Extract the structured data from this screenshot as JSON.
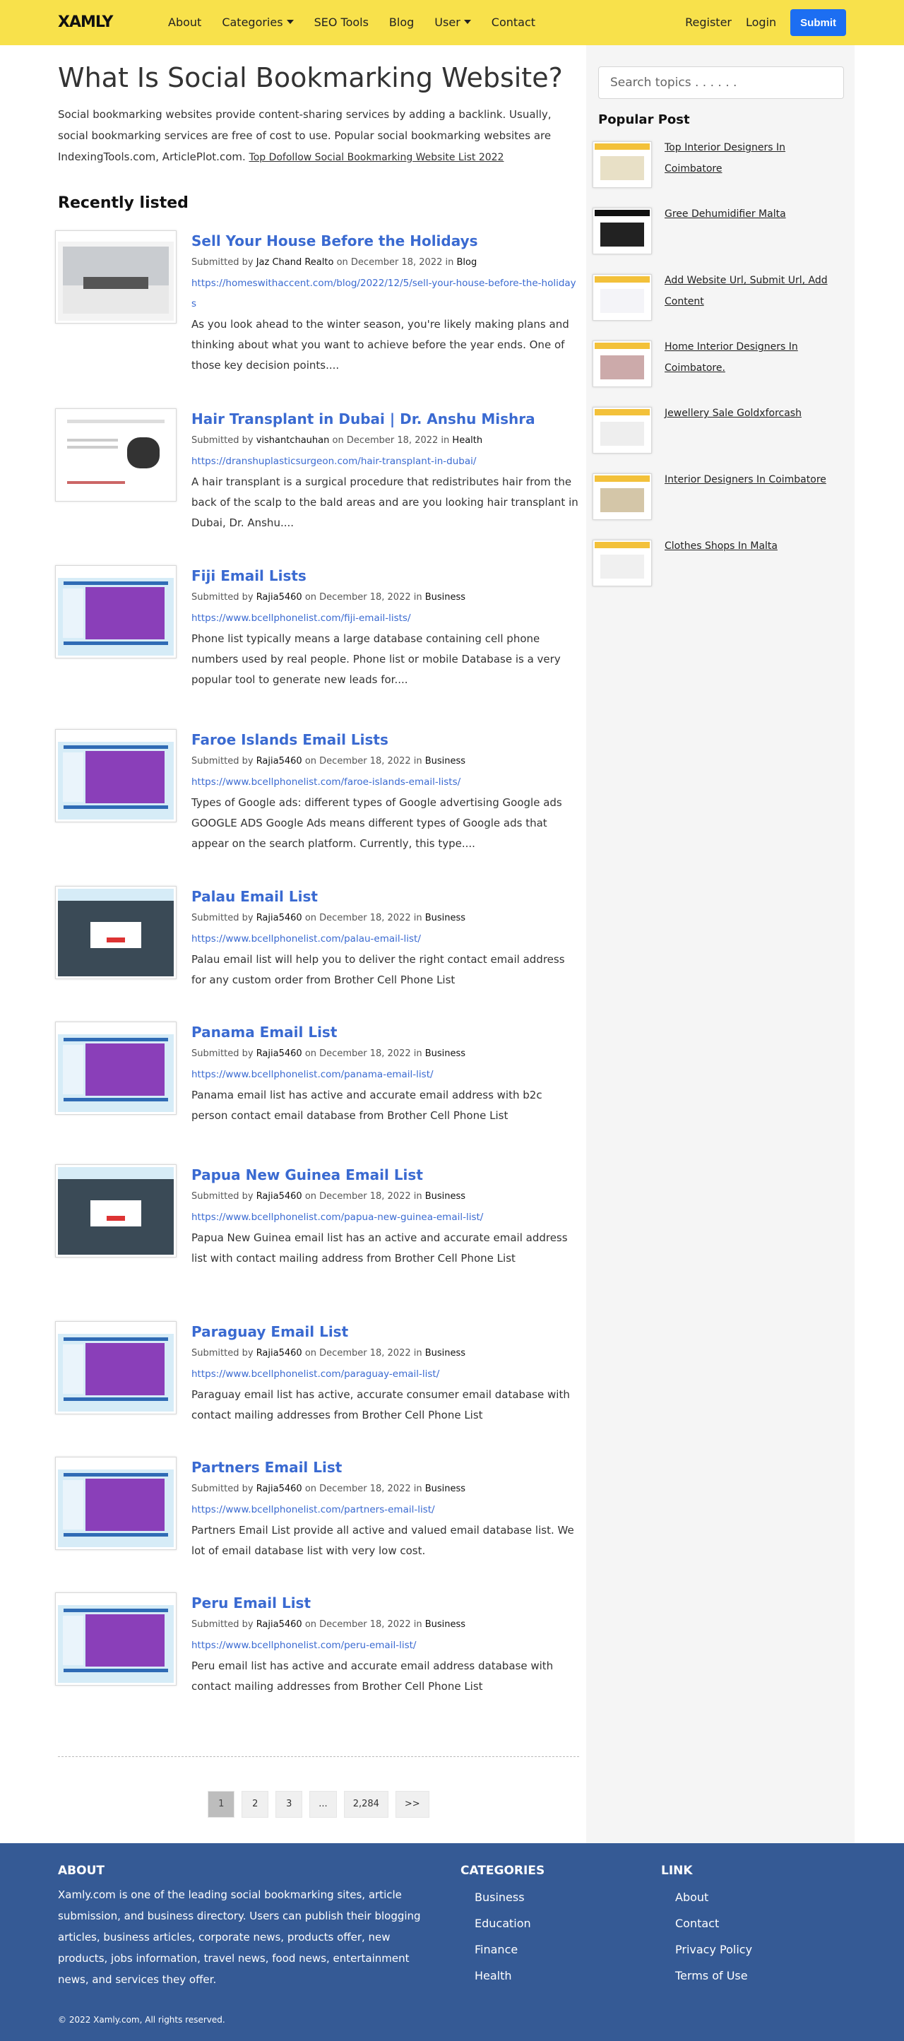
{
  "nav": {
    "logo": "XAMLY",
    "links": [
      "About",
      "Categories",
      "SEO Tools",
      "Blog",
      "User",
      "Contact"
    ],
    "register": "Register",
    "login": "Login",
    "submit": "Submit"
  },
  "page": {
    "title": "What Is Social Bookmarking Website?",
    "intro": "Social bookmarking websites provide content-sharing services by adding a backlink. Usually, social bookmarking services are free of cost to use. Popular social bookmarking websites are IndexingTools.com, ArticlePlot.com. ",
    "intro_link": "Top Dofollow Social Bookmarking Website List 2022",
    "recent_title": "Recently listed"
  },
  "meta_labels": {
    "submitted_by": "Submitted by",
    "on": "on",
    "in": "in"
  },
  "posts": [
    {
      "title": "Sell Your House Before the Holidays",
      "author": "Jaz Chand Realto",
      "date": "December 18, 2022",
      "category": "Blog",
      "url": "https://homeswithaccent.com/blog/2022/12/5/sell-your-house-before-the-holidays",
      "excerpt": "As you look ahead to the winter season, you're likely making plans and thinking about what you want to achieve before the year ends. One of those key decision points...."
    },
    {
      "title": "Hair Transplant in Dubai | Dr. Anshu Mishra",
      "author": "vishantchauhan",
      "date": "December 18, 2022",
      "category": "Health",
      "url": "https://dranshuplasticsurgeon.com/hair-transplant-in-dubai/",
      "excerpt": "A hair transplant is a surgical procedure that redistributes hair from the back of the scalp to the bald areas and are you looking hair transplant in Dubai, Dr. Anshu...."
    },
    {
      "title": "Fiji Email Lists",
      "author": "Rajia5460",
      "date": "December 18, 2022",
      "category": "Business",
      "url": "https://www.bcellphonelist.com/fiji-email-lists/",
      "excerpt": "Phone list typically means a large database containing cell phone numbers used by real people. Phone list or mobile Database is a very popular tool to generate new leads for...."
    },
    {
      "title": "Faroe Islands Email Lists",
      "author": "Rajia5460",
      "date": "December 18, 2022",
      "category": "Business",
      "url": "https://www.bcellphonelist.com/faroe-islands-email-lists/",
      "excerpt": "Types of Google ads: different types of Google advertising Google ads GOOGLE ADS Google Ads means different types of Google ads that appear on the search platform. Currently, this type...."
    },
    {
      "title": "Palau Email List",
      "author": "Rajia5460",
      "date": "December 18, 2022",
      "category": "Business",
      "url": "https://www.bcellphonelist.com/palau-email-list/",
      "excerpt": "Palau email list will help you to deliver the right contact email address for any custom order from Brother Cell Phone List"
    },
    {
      "title": "Panama Email List",
      "author": "Rajia5460",
      "date": "December 18, 2022",
      "category": "Business",
      "url": "https://www.bcellphonelist.com/panama-email-list/",
      "excerpt": "Panama email list has active and accurate email address with b2c person contact email database from Brother Cell Phone List"
    },
    {
      "title": "Papua New Guinea Email List",
      "author": "Rajia5460",
      "date": "December 18, 2022",
      "category": "Business",
      "url": "https://www.bcellphonelist.com/papua-new-guinea-email-list/",
      "excerpt": "Papua New Guinea email list has an active and accurate email address list with contact mailing address from Brother Cell Phone List"
    },
    {
      "title": "Paraguay Email List",
      "author": "Rajia5460",
      "date": "December 18, 2022",
      "category": "Business",
      "url": "https://www.bcellphonelist.com/paraguay-email-list/",
      "excerpt": "Paraguay email list has active, accurate consumer email database with contact mailing addresses from Brother Cell Phone List"
    },
    {
      "title": "Partners Email List",
      "author": "Rajia5460",
      "date": "December 18, 2022",
      "category": "Business",
      "url": "https://www.bcellphonelist.com/partners-email-list/",
      "excerpt": "Partners Email List provide all active and valued email database list. We lot of email database list with very low cost."
    },
    {
      "title": "Peru Email List",
      "author": "Rajia5460",
      "date": "December 18, 2022",
      "category": "Business",
      "url": "https://www.bcellphonelist.com/peru-email-list/",
      "excerpt": "Peru email list has active and accurate email address database with contact mailing addresses from Brother Cell Phone List"
    }
  ],
  "pagination": [
    "1",
    "2",
    "3",
    "...",
    "2,284",
    ">>"
  ],
  "sidebar": {
    "search_placeholder": "Search topics . . . . . .",
    "popular_title": "Popular Post",
    "popular": [
      "Top Interior Designers In Coimbatore",
      "Gree Dehumidifier Malta",
      "Add Website Url, Submit Url, Add Content",
      "Home Interior Designers In Coimbatore.",
      "Jewellery Sale Goldxforcash",
      "Interior Designers In Coimbatore",
      "Clothes Shops In Malta"
    ]
  },
  "footer": {
    "about_title": "ABOUT",
    "about_text": "Xamly.com is one of the leading social bookmarking sites, article submission, and business directory. Users can publish their blogging articles, business articles, corporate news, products offer, new products, jobs information, travel news, food news, entertainment news, and services they offer.",
    "categories_title": "CATEGORIES",
    "categories": [
      "Business",
      "Education",
      "Finance",
      "Health"
    ],
    "link_title": "LINK",
    "links": [
      "About",
      "Contact",
      "Privacy Policy",
      "Terms of Use"
    ],
    "copyright": "© 2022 Xamly.com, All rights reserved."
  },
  "colors": {
    "nav_bg": "#f8e14b",
    "accent": "#1c6ef2",
    "link": "#3a6ad1",
    "footer_bg": "#355a95"
  }
}
